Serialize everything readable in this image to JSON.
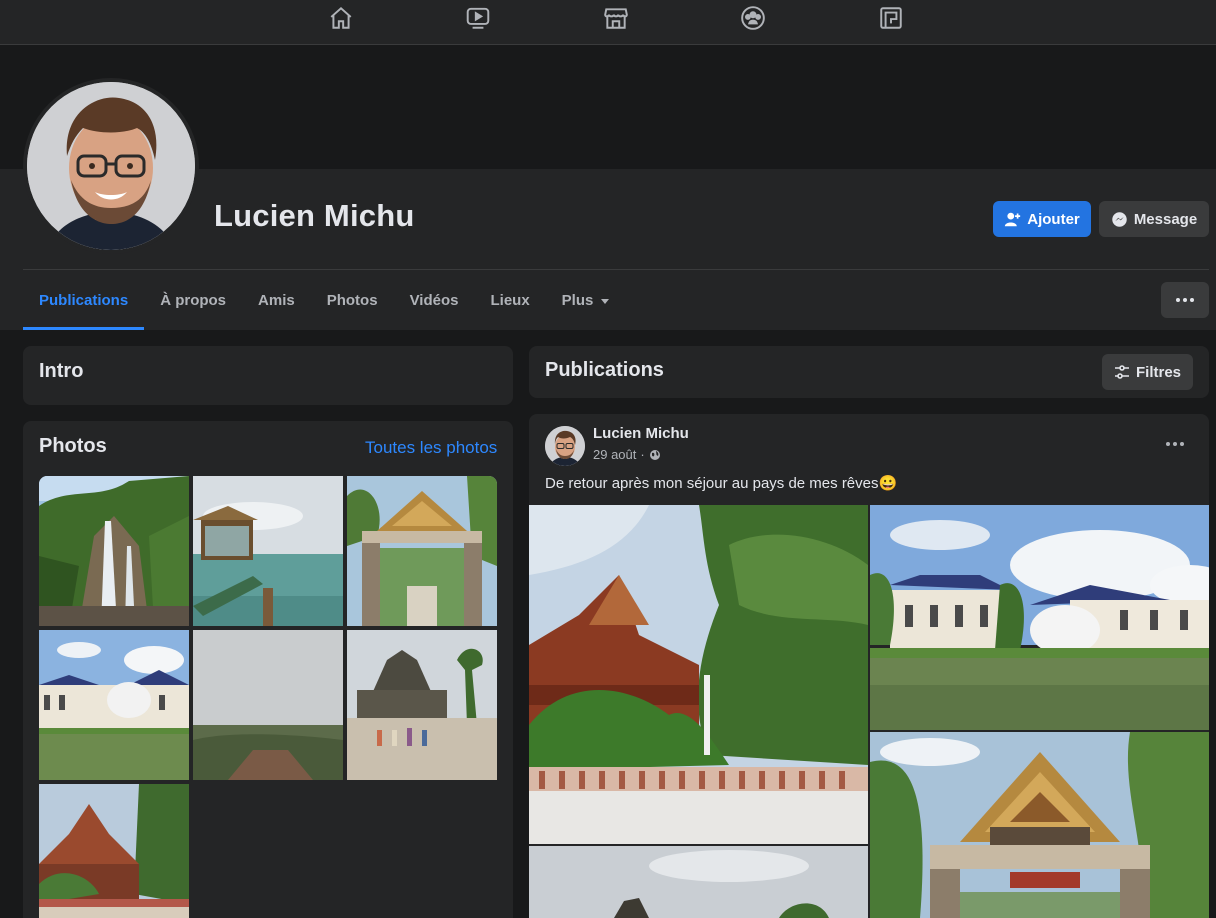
{
  "nav": {
    "icons": [
      "home-icon",
      "watch-icon",
      "marketplace-icon",
      "groups-icon",
      "gaming-icon"
    ]
  },
  "profile": {
    "name": "Lucien Michu",
    "add_label": "Ajouter",
    "message_label": "Message"
  },
  "tabs": [
    {
      "label": "Publications",
      "active": true
    },
    {
      "label": "À propos"
    },
    {
      "label": "Amis"
    },
    {
      "label": "Photos"
    },
    {
      "label": "Vidéos"
    },
    {
      "label": "Lieux"
    },
    {
      "label": "Plus"
    }
  ],
  "intro": {
    "title": "Intro"
  },
  "photos": {
    "title": "Photos",
    "all_link": "Toutes les photos"
  },
  "publications": {
    "title": "Publications",
    "filters_label": "Filtres"
  },
  "post": {
    "author": "Lucien Michu",
    "date": "29 août",
    "separator": "·",
    "text": "De retour après mon séjour au pays de mes rêves😀"
  },
  "colors": {
    "accent": "#2d88ff",
    "button_primary": "#2374e1",
    "card": "#242526",
    "background": "#18191a"
  }
}
